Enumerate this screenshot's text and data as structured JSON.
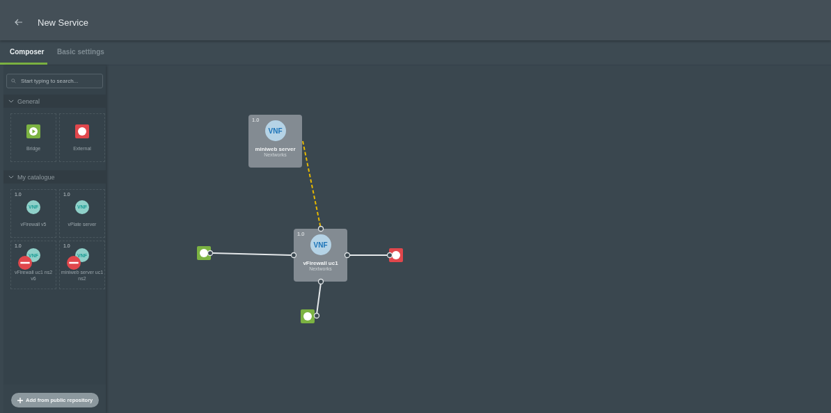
{
  "header": {
    "title": "New Service"
  },
  "tabs": [
    {
      "label": "Composer",
      "selected": true
    },
    {
      "label": "Basic settings",
      "selected": false
    }
  ],
  "search": {
    "placeholder": "Start typing to search..."
  },
  "sections": [
    {
      "title": "General",
      "expanded": true,
      "items": [
        {
          "kind": "bridge",
          "name": "Bridge"
        },
        {
          "kind": "external",
          "name": "External"
        }
      ]
    },
    {
      "title": "My catalogue",
      "expanded": true,
      "items": [
        {
          "kind": "vnf",
          "version": "1.0",
          "badge": "VNF",
          "name": "vFirewall v5",
          "disabled": false
        },
        {
          "kind": "vnf",
          "version": "1.0",
          "badge": "VNF",
          "name": "vPlate server",
          "disabled": false
        },
        {
          "kind": "vnf",
          "version": "1.0",
          "badge": "VNF",
          "name": "vFirewall uc1 ns2 v6",
          "disabled": true
        },
        {
          "kind": "vnf",
          "version": "1.0",
          "badge": "VNF",
          "name": "miniweb server uc1 ns2",
          "disabled": true
        }
      ]
    }
  ],
  "add_button": {
    "label": "Add from public repository"
  },
  "canvas": {
    "nodes": [
      {
        "kind": "vnf",
        "version": "1.0",
        "badge": "VNF",
        "name": "miniweb server",
        "vendor": "Nextworks"
      },
      {
        "kind": "vnf",
        "version": "1.0",
        "badge": "VNF",
        "name": "vFirewall uc1",
        "vendor": "Nextworks"
      },
      {
        "kind": "bridge"
      },
      {
        "kind": "external"
      },
      {
        "kind": "bridge"
      }
    ],
    "links": [
      {
        "kind": "management"
      },
      {
        "kind": "data"
      },
      {
        "kind": "data"
      },
      {
        "kind": "data"
      }
    ]
  }
}
